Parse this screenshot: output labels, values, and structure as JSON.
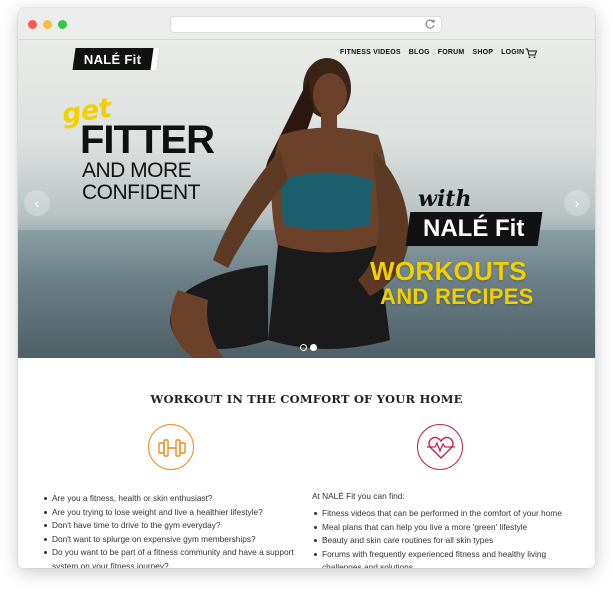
{
  "nav": {
    "logo": "NALÉ Fit",
    "items": [
      "FITNESS VIDEOS",
      "BLOG",
      "FORUM",
      "SHOP",
      "LOGIN"
    ]
  },
  "hero": {
    "get": "get",
    "fitter": "FITTER",
    "and_more": "AND MORE",
    "confident": "CONFIDENT",
    "with": "with",
    "with_logo": "NALÉ Fit",
    "workouts": "WORKOUTS",
    "recipes": "AND RECIPES"
  },
  "section": {
    "title": "WORKOUT IN THE COMFORT OF YOUR HOME",
    "left_items": [
      "Are you a fitness, health or skin enthusiast?",
      "Are you trying to lose weight and live a healthier lifestyle?",
      "Don't have time to drive to the gym everyday?",
      "Don't want to splurge on expensive gym memberships?",
      "Do you want to be part of a fitness community and have a support system on your fitness journey?"
    ],
    "intro": "At NALÉ Fit you can find:",
    "right_items": [
      "Fitness videos that can be performed in the comfort of your home",
      "Meal plans that can help you live a more 'green' lifestyle",
      "Beauty and skin care routines for all skin types",
      "Forums with frequently experienced fitness and healthy living challenges and solutions"
    ]
  },
  "colors": {
    "yellow": "#f2d000",
    "orange": "#f08c1d",
    "red": "#c8234b"
  }
}
